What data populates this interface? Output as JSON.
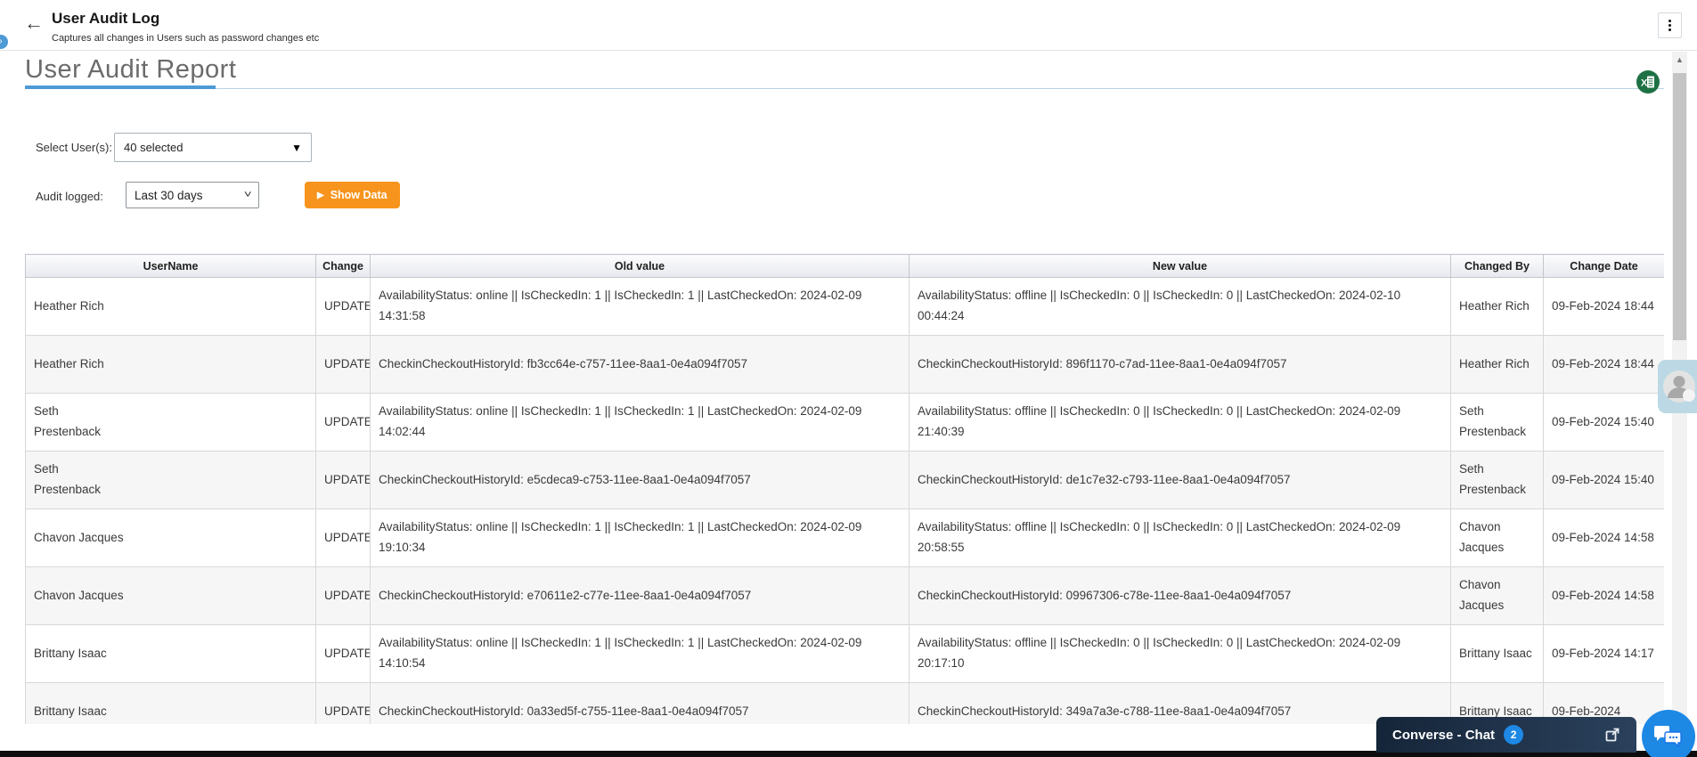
{
  "header": {
    "title": "User Audit Log",
    "subtitle": "Captures all changes in Users such as password changes etc",
    "back_icon": "arrow-left",
    "menu_icon": "kebab-menu",
    "edge_icon": "chevron-right"
  },
  "report": {
    "heading": "User Audit Report",
    "export_icon": "excel-export"
  },
  "filters": {
    "select_users_label": "Select User(s):",
    "select_users_value": "40 selected",
    "audit_logged_label": "Audit logged:",
    "audit_logged_value": "Last 30 days",
    "show_data_label": "Show Data",
    "show_data_icon": "play-triangle"
  },
  "table": {
    "columns": [
      "UserName",
      "Change",
      "Old value",
      "New value",
      "Changed By",
      "Change Date"
    ],
    "rows": [
      {
        "user": "Heather Rich",
        "change": "UPDATE",
        "old": "AvailabilityStatus: online || IsCheckedIn: 1 || IsCheckedIn: 1 || LastCheckedOn: 2024-02-09 14:31:58",
        "new": "AvailabilityStatus: offline || IsCheckedIn: 0 || IsCheckedIn: 0 || LastCheckedOn: 2024-02-10 00:44:24",
        "by": "Heather Rich",
        "date": "09-Feb-2024 18:44"
      },
      {
        "user": "Heather Rich",
        "change": "UPDATE",
        "old": "CheckinCheckoutHistoryId: fb3cc64e-c757-11ee-8aa1-0e4a094f7057",
        "new": "CheckinCheckoutHistoryId: 896f1170-c7ad-11ee-8aa1-0e4a094f7057",
        "by": "Heather Rich",
        "date": "09-Feb-2024 18:44"
      },
      {
        "user": "Seth\nPrestenback",
        "change": "UPDATE",
        "old": "AvailabilityStatus: online || IsCheckedIn: 1 || IsCheckedIn: 1 || LastCheckedOn: 2024-02-09 14:02:44",
        "new": "AvailabilityStatus: offline || IsCheckedIn: 0 || IsCheckedIn: 0 || LastCheckedOn: 2024-02-09 21:40:39",
        "by": "Seth Prestenback",
        "date": "09-Feb-2024 15:40"
      },
      {
        "user": "Seth\nPrestenback",
        "change": "UPDATE",
        "old": "CheckinCheckoutHistoryId: e5cdeca9-c753-11ee-8aa1-0e4a094f7057",
        "new": "CheckinCheckoutHistoryId: de1c7e32-c793-11ee-8aa1-0e4a094f7057",
        "by": "Seth Prestenback",
        "date": "09-Feb-2024 15:40"
      },
      {
        "user": "Chavon Jacques",
        "change": "UPDATE",
        "old": "AvailabilityStatus: online || IsCheckedIn: 1 || IsCheckedIn: 1 || LastCheckedOn: 2024-02-09 19:10:34",
        "new": "AvailabilityStatus: offline || IsCheckedIn: 0 || IsCheckedIn: 0 || LastCheckedOn: 2024-02-09 20:58:55",
        "by": "Chavon Jacques",
        "date": "09-Feb-2024 14:58"
      },
      {
        "user": "Chavon Jacques",
        "change": "UPDATE",
        "old": "CheckinCheckoutHistoryId: e70611e2-c77e-11ee-8aa1-0e4a094f7057",
        "new": "CheckinCheckoutHistoryId: 09967306-c78e-11ee-8aa1-0e4a094f7057",
        "by": "Chavon Jacques",
        "date": "09-Feb-2024 14:58"
      },
      {
        "user": "Brittany Isaac",
        "change": "UPDATE",
        "old": "AvailabilityStatus: online || IsCheckedIn: 1 || IsCheckedIn: 1 || LastCheckedOn: 2024-02-09 14:10:54",
        "new": "AvailabilityStatus: offline || IsCheckedIn: 0 || IsCheckedIn: 0 || LastCheckedOn: 2024-02-09 20:17:10",
        "by": "Brittany Isaac",
        "date": "09-Feb-2024 14:17"
      },
      {
        "user": "Brittany Isaac",
        "change": "UPDATE",
        "old": "CheckinCheckoutHistoryId: 0a33ed5f-c755-11ee-8aa1-0e4a094f7057",
        "new": "CheckinCheckoutHistoryId: 349a7a3e-c788-11ee-8aa1-0e4a094f7057",
        "by": "Brittany Isaac",
        "date": "09-Feb-2024"
      }
    ]
  },
  "chat": {
    "label": "Converse - Chat",
    "badge": "2",
    "expand_icon": "open-in-new",
    "fab_icon": "chat-bubbles"
  },
  "scrollbar": {
    "up_arrow": "▲"
  },
  "colors": {
    "accent-blue": "#4d9ad5",
    "accent-orange": "#f7941d",
    "badge-blue": "#1e88e5",
    "excel-green": "#1e7145",
    "chat-navy": "#1f3048"
  }
}
